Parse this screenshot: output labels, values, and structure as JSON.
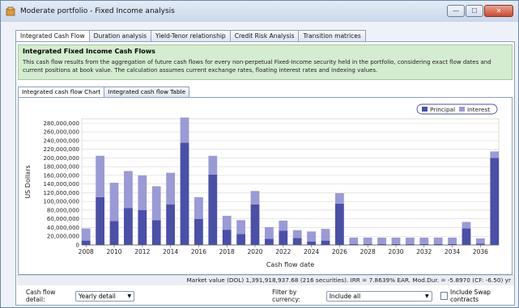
{
  "window": {
    "title": "Moderate portfolio - Fixed Income analysis",
    "controls": {
      "minimize": "—",
      "maximize": "☐",
      "close": "✕"
    }
  },
  "tabs": [
    {
      "label": "Integrated Cash Flow",
      "active": true
    },
    {
      "label": "Duration analysis",
      "active": false
    },
    {
      "label": "Yield-Tenor relationship",
      "active": false
    },
    {
      "label": "Credit Risk Analysis",
      "active": false
    },
    {
      "label": "Transition matrices",
      "active": false
    }
  ],
  "info": {
    "title": "Integrated Fixed Income Cash Flows",
    "body": "This cash flow results from the aggregation of future cash flows for every non-perpetual Fixed-Income security held in the portfolio, considering exact flow dates and current positions at book value. The calculation assumes current exchange rates, floating interest rates and indexing values."
  },
  "subtabs": [
    {
      "label": "Integrated cash flow Chart",
      "active": true
    },
    {
      "label": "Integrated cash flow Table",
      "active": false
    }
  ],
  "chart_data": {
    "type": "bar",
    "stacked": true,
    "x": [
      2008,
      2009,
      2010,
      2011,
      2012,
      2013,
      2014,
      2015,
      2016,
      2017,
      2018,
      2019,
      2020,
      2021,
      2022,
      2023,
      2024,
      2025,
      2026,
      2027,
      2028,
      2029,
      2030,
      2031,
      2032,
      2033,
      2034,
      2035,
      2036,
      2037
    ],
    "series": [
      {
        "name": "Principal",
        "color": "#4a4fa8",
        "values": [
          10000000,
          110000000,
          55000000,
          85000000,
          80000000,
          57000000,
          93000000,
          235000000,
          60000000,
          162000000,
          35000000,
          25000000,
          93000000,
          14000000,
          33000000,
          16000000,
          8000000,
          10000000,
          95000000,
          2000000,
          2000000,
          2000000,
          2000000,
          2000000,
          2000000,
          2000000,
          2000000,
          38000000,
          3000000,
          200000000
        ]
      },
      {
        "name": "Interest",
        "color": "#9a9ad6",
        "values": [
          28000000,
          95000000,
          88000000,
          85000000,
          80000000,
          78000000,
          73000000,
          58000000,
          50000000,
          43000000,
          32000000,
          32000000,
          31000000,
          27000000,
          23000000,
          18000000,
          23000000,
          27000000,
          24000000,
          15000000,
          15000000,
          15000000,
          15000000,
          15000000,
          15000000,
          15000000,
          15000000,
          15000000,
          12000000,
          15000000
        ]
      }
    ],
    "xticks": [
      "2008",
      "2010",
      "2012",
      "2014",
      "2016",
      "2018",
      "2020",
      "2022",
      "2024",
      "2026",
      "2028",
      "2030",
      "2032",
      "2034",
      "2036"
    ],
    "yticks": [
      "0",
      "20,000,000",
      "40,000,000",
      "60,000,000",
      "80,000,000",
      "100,000,000",
      "120,000,000",
      "140,000,000",
      "160,000,000",
      "180,000,000",
      "200,000,000",
      "220,000,000",
      "240,000,000",
      "260,000,000",
      "280,000,000"
    ],
    "ylim": [
      0,
      290000000
    ],
    "xlabel": "Cash flow date",
    "ylabel": "US Dollars",
    "grid": "horizontal",
    "legend_position": "top-right"
  },
  "status": {
    "text": "Market value (DOL) 1,391,918,937.68 (216 securities). IRR = 7.8639% EAR. Mod.Dur. = -5.8970 (CF: -6.50) yr"
  },
  "controls": {
    "cashflow_detail_label": "Cash flow detail:",
    "cashflow_detail_value": "Yearly detail",
    "filter_label": "Filter by currency:",
    "filter_value": "Include all",
    "swap_label": "Include Swap contracts",
    "swap_checked": false
  }
}
